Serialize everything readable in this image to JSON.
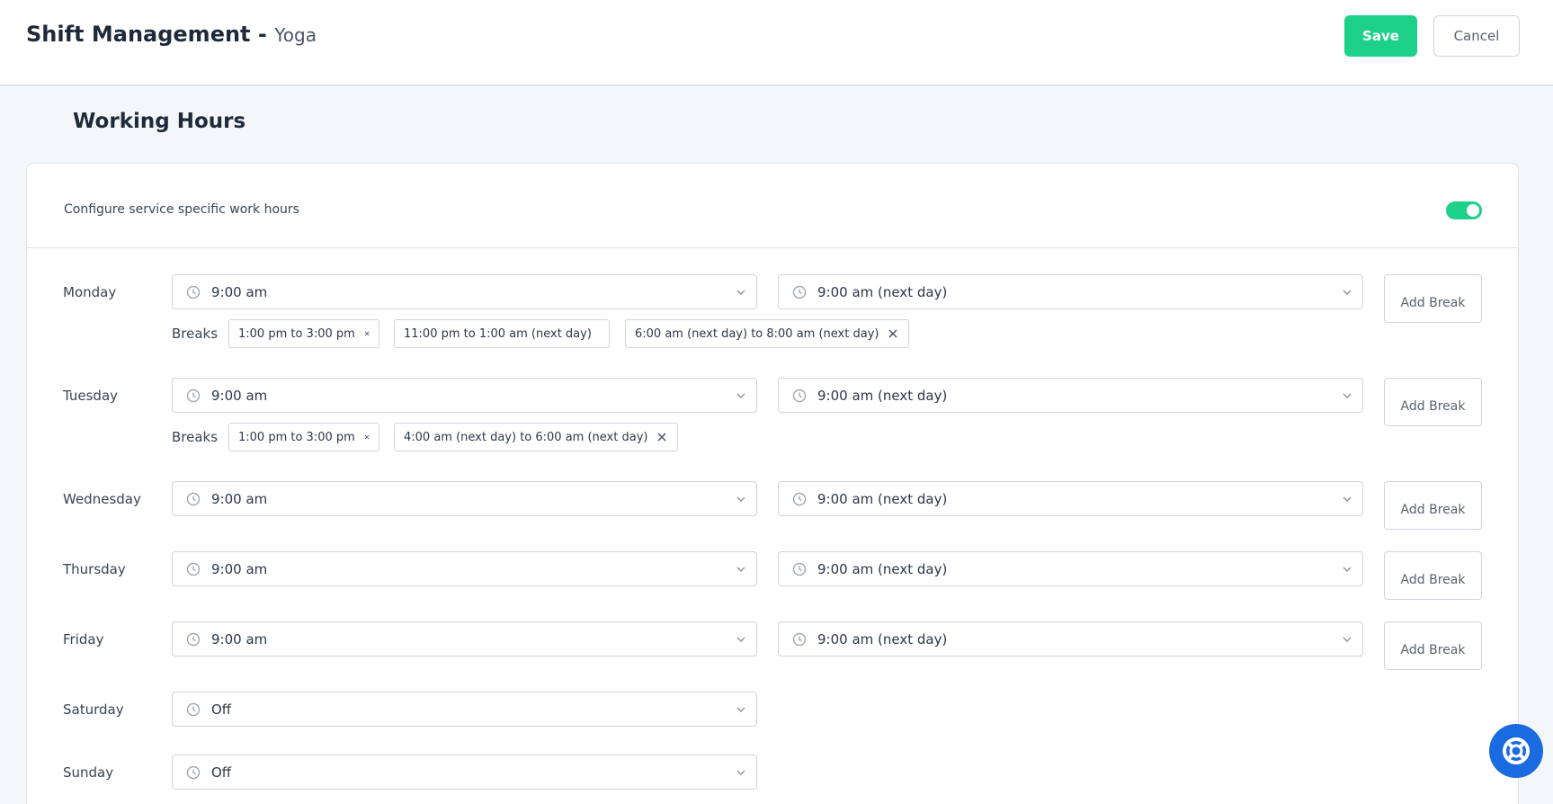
{
  "header": {
    "title": "Shift Management -",
    "service": "Yoga",
    "save_label": "Save",
    "cancel_label": "Cancel"
  },
  "section": {
    "title": "Working Hours"
  },
  "config": {
    "label": "Configure service specific work hours",
    "enabled": true
  },
  "breaks_label": "Breaks",
  "add_break_label": "Add Break",
  "days": [
    {
      "name": "Monday",
      "start": "9:00 am",
      "end": "9:00 am (next day)",
      "breaks": [
        "1:00 pm to 3:00 pm",
        "11:00 pm to 1:00 am (next day)",
        "6:00 am (next day) to 8:00 am (next day)"
      ]
    },
    {
      "name": "Tuesday",
      "start": "9:00 am",
      "end": "9:00 am (next day)",
      "breaks": [
        "1:00 pm to 3:00 pm",
        "4:00 am (next day) to 6:00 am (next day)"
      ]
    },
    {
      "name": "Wednesday",
      "start": "9:00 am",
      "end": "9:00 am (next day)",
      "breaks": []
    },
    {
      "name": "Thursday",
      "start": "9:00 am",
      "end": "9:00 am (next day)",
      "breaks": []
    },
    {
      "name": "Friday",
      "start": "9:00 am",
      "end": "9:00 am (next day)",
      "breaks": []
    },
    {
      "name": "Saturday",
      "start": "Off",
      "breaks": []
    },
    {
      "name": "Sunday",
      "start": "Off",
      "breaks": []
    }
  ],
  "colors": {
    "accent": "#1ed18a",
    "help": "#1a6ae0"
  },
  "icons": {
    "time": "clock-icon",
    "dropdown": "chevron-down-icon",
    "remove": "close-icon",
    "help": "lifebuoy-icon"
  }
}
